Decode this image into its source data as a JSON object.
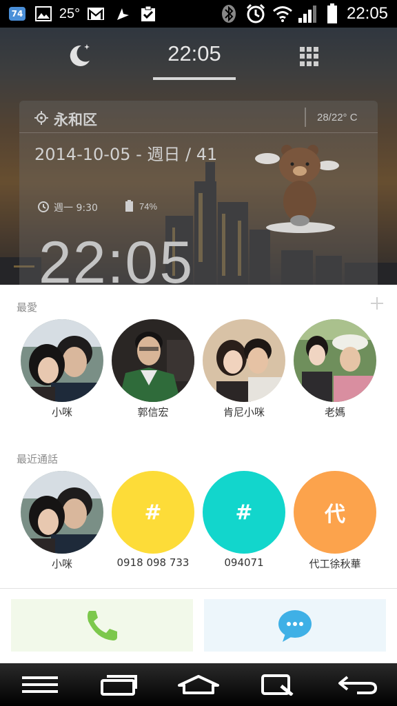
{
  "status_bar": {
    "notification_badge": "74",
    "temperature": "25°",
    "time": "22:05",
    "icons": [
      "android-icon",
      "gallery-icon",
      "gmail-icon",
      "navigation-icon",
      "clipboard-check-icon",
      "bluetooth-icon",
      "alarm-icon",
      "wifi-icon",
      "signal-icon",
      "battery-icon"
    ]
  },
  "widget": {
    "tabs": {
      "night_icon": "moon-icon",
      "clock_tab": "22:05",
      "apps_icon": "grid-icon"
    },
    "weather_card": {
      "location": "永和区",
      "temperature": "28/22° C",
      "date_line": "2014-10-05 - 週日 / 41",
      "alarm": "週一 9:30",
      "battery": "74%",
      "big_clock": "22:05"
    }
  },
  "favorites": {
    "title": "最愛",
    "contacts": [
      {
        "name": "小咪"
      },
      {
        "name": "郭信宏"
      },
      {
        "name": "肯尼小咪"
      },
      {
        "name": "老媽"
      }
    ]
  },
  "recent": {
    "title": "最近通話",
    "contacts": [
      {
        "name": "小咪",
        "avatar_type": "photo"
      },
      {
        "name": "0918 098 733",
        "avatar_letter": "#",
        "color": "#fddc38"
      },
      {
        "name": "094071",
        "avatar_letter": "#",
        "color": "#12d6cc"
      },
      {
        "name": "代工徐秋華",
        "avatar_letter": "代",
        "color": "#fca34c"
      }
    ]
  },
  "actions": {
    "call_color": "#7cc84c",
    "message_color": "#3fb0e6"
  },
  "navigation": [
    "menu-icon",
    "recent-apps-icon",
    "home-icon",
    "qslide-icon",
    "back-icon"
  ]
}
